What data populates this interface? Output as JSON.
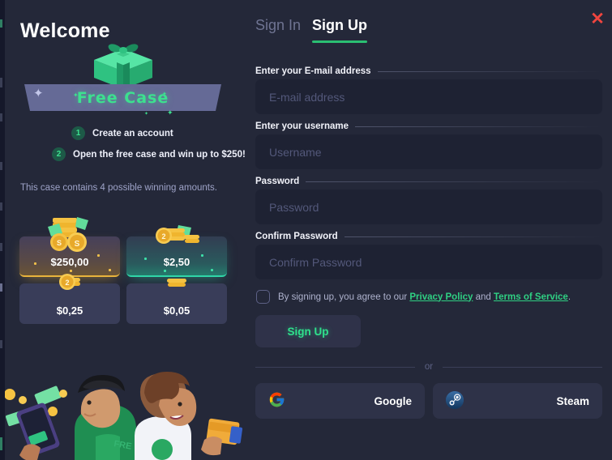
{
  "modal": {
    "close_icon": "close-icon",
    "close_glyph": "✕",
    "accent_green": "#2fe08c",
    "accent_red": "#f0453f",
    "panel_bg": "#242839",
    "input_bg": "#1e2233"
  },
  "left": {
    "welcome_title": "Welcome",
    "banner_label": "Free Case",
    "gift_icon": "gift-box-icon",
    "steps": [
      {
        "num": "1",
        "text": "Create an account"
      },
      {
        "num": "2",
        "text": "Open the free case and win up to $250!"
      }
    ],
    "contains_text": "This case contains 4 possible winning amounts.",
    "prizes": [
      {
        "amount": "$250,00",
        "tier": "gold",
        "art": "coins-stack-cash-icon"
      },
      {
        "amount": "$2,50",
        "tier": "teal",
        "art": "coins-cash-icon"
      },
      {
        "amount": "$0,25",
        "tier": "plain",
        "art": "single-coin-icon"
      },
      {
        "amount": "$0,05",
        "tier": "plain",
        "art": "small-coin-icon"
      }
    ],
    "illustration": "two-people-with-money-illustration"
  },
  "right": {
    "tabs": [
      {
        "label": "Sign In",
        "active": false
      },
      {
        "label": "Sign Up",
        "active": true
      }
    ],
    "fields": [
      {
        "label": "Enter your E-mail address",
        "placeholder": "E-mail address",
        "value": "",
        "type": "text"
      },
      {
        "label": "Enter your username",
        "placeholder": "Username",
        "value": "",
        "type": "text"
      },
      {
        "label": "Password",
        "placeholder": "Password",
        "value": "",
        "type": "password"
      },
      {
        "label": "Confirm Password",
        "placeholder": "Confirm Password",
        "value": "",
        "type": "password"
      }
    ],
    "terms": {
      "checked": false,
      "prefix": "By signing up, you agree to our ",
      "privacy_link": "Privacy Policy",
      "conjunction": " and ",
      "terms_link": "Terms of Service",
      "suffix": "."
    },
    "submit_label": "Sign Up",
    "divider_label": "or",
    "social": [
      {
        "label": "Google",
        "icon": "google-icon"
      },
      {
        "label": "Steam",
        "icon": "steam-icon"
      }
    ]
  }
}
